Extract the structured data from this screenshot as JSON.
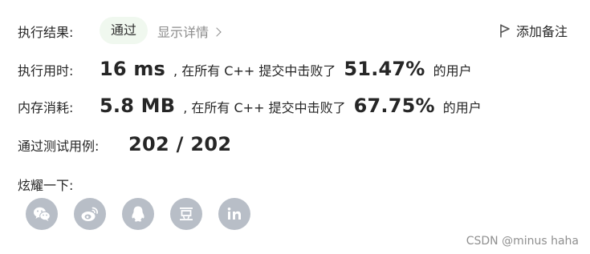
{
  "result": {
    "label": "执行结果:",
    "status": "通过",
    "details_link": "显示详情",
    "add_note": "添加备注"
  },
  "runtime": {
    "label": "执行用时:",
    "value": "16 ms",
    "middle_text": ", 在所有 C++ 提交中击败了",
    "percent": "51.47%",
    "tail_text": "的用户"
  },
  "memory": {
    "label": "内存消耗:",
    "value": "5.8 MB",
    "middle_text": ", 在所有 C++ 提交中击败了",
    "percent": "67.75%",
    "tail_text": "的用户"
  },
  "testcases": {
    "label": "通过测试用例:",
    "value": "202 / 202"
  },
  "share": {
    "label": "炫耀一下:",
    "icons": [
      {
        "name": "wechat-icon"
      },
      {
        "name": "weibo-icon"
      },
      {
        "name": "qq-icon"
      },
      {
        "name": "douban-icon"
      },
      {
        "name": "linkedin-icon"
      }
    ],
    "icon_color": "#b8bec7"
  },
  "watermark": "CSDN @minus haha"
}
